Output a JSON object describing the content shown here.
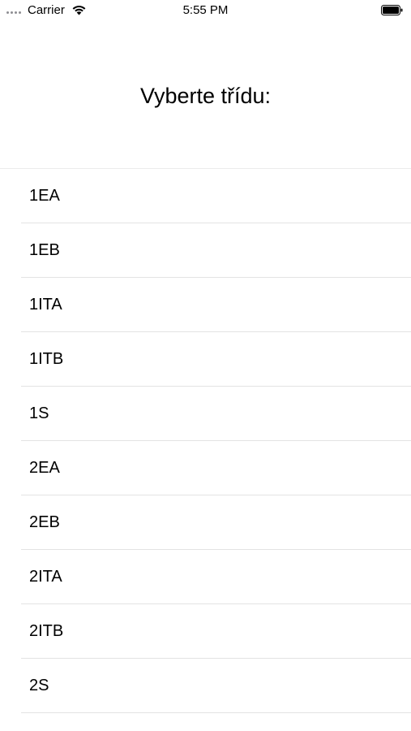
{
  "status_bar": {
    "carrier": "Carrier",
    "time": "5:55 PM"
  },
  "title": "Vyberte třídu:",
  "classes": [
    "1EA",
    "1EB",
    "1ITA",
    "1ITB",
    "1S",
    "2EA",
    "2EB",
    "2ITA",
    "2ITB",
    "2S"
  ]
}
